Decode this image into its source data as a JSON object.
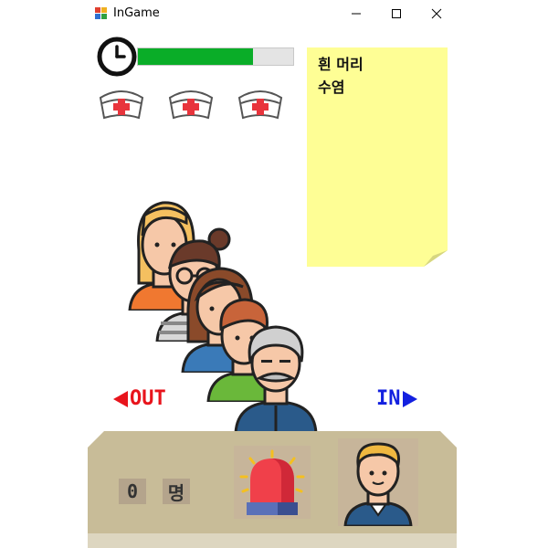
{
  "window": {
    "title": "InGame"
  },
  "timer": {
    "remaining_fraction": 0.74,
    "fill_color": "#0aad28",
    "icon": "clock-icon"
  },
  "lives": {
    "count": 3,
    "icon": "nurse-cap-icon"
  },
  "note": {
    "lines": [
      "흰 머리",
      "수염"
    ],
    "color": "#fefe95"
  },
  "queue": {
    "people": [
      "woman-blonde",
      "woman-glasses",
      "woman-brown-hair",
      "man-green-shirt",
      "old-man-mustache"
    ]
  },
  "controls": {
    "out_label": "OUT",
    "in_label": "IN",
    "out_color": "#e8141c",
    "in_color": "#1320e0"
  },
  "counter": {
    "value": "0",
    "unit": "명"
  },
  "buttons": {
    "alarm_icon": "siren-icon"
  },
  "inspector": {
    "icon": "man-avatar-icon"
  }
}
